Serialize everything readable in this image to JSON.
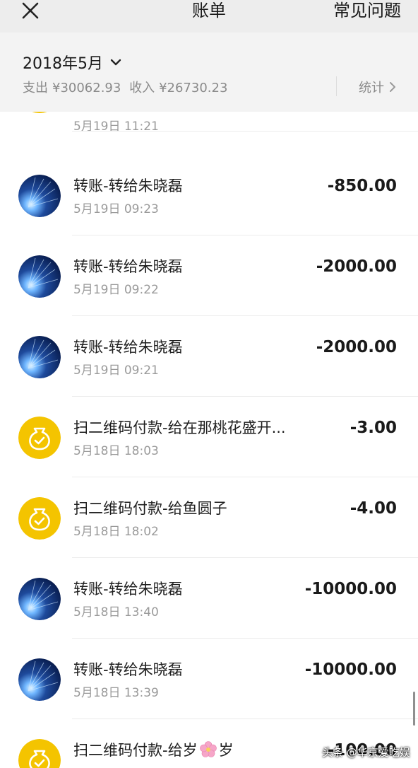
{
  "nav": {
    "title": "账单",
    "faq_label": "常见问题",
    "close_icon": "close-icon"
  },
  "summary": {
    "month": "2018年5月",
    "expense_label": "支出",
    "expense_amount": "¥30062.93",
    "income_label": "收入",
    "income_amount": "¥26730.23",
    "stats_label": "统计"
  },
  "colors": {
    "nav_bg": "#ededed",
    "summary_bg": "#f3f3f3",
    "coin_yellow": "#f4c400",
    "avatar_blue": "#1e4a9c"
  },
  "transactions": [
    {
      "title": "",
      "time": "5月19日 11:21",
      "amount": "",
      "icon": "money-bag-icon"
    },
    {
      "title": "转账-转给朱晓磊",
      "time": "5月19日 09:23",
      "amount": "-850.00",
      "icon": "contact-avatar"
    },
    {
      "title": "转账-转给朱晓磊",
      "time": "5月19日 09:22",
      "amount": "-2000.00",
      "icon": "contact-avatar"
    },
    {
      "title": "转账-转给朱晓磊",
      "time": "5月19日 09:21",
      "amount": "-2000.00",
      "icon": "contact-avatar"
    },
    {
      "title": "扫二维码付款-给在那桃花盛开...",
      "time": "5月18日 18:03",
      "amount": "-3.00",
      "icon": "money-bag-icon"
    },
    {
      "title": "扫二维码付款-给鱼圆子",
      "time": "5月18日 18:02",
      "amount": "-4.00",
      "icon": "money-bag-icon"
    },
    {
      "title": "转账-转给朱晓磊",
      "time": "5月18日 13:40",
      "amount": "-10000.00",
      "icon": "contact-avatar"
    },
    {
      "title": "转账-转给朱晓磊",
      "time": "5月18日 13:39",
      "amount": "-10000.00",
      "icon": "contact-avatar"
    },
    {
      "title_before": "扫二维码付款-给岁",
      "title_after": "岁",
      "title_emoji": "cherry-blossom-icon",
      "time": "",
      "amount": "-100.00",
      "icon": "money-bag-icon"
    }
  ],
  "watermark": "头条 @华京爱吃娱"
}
